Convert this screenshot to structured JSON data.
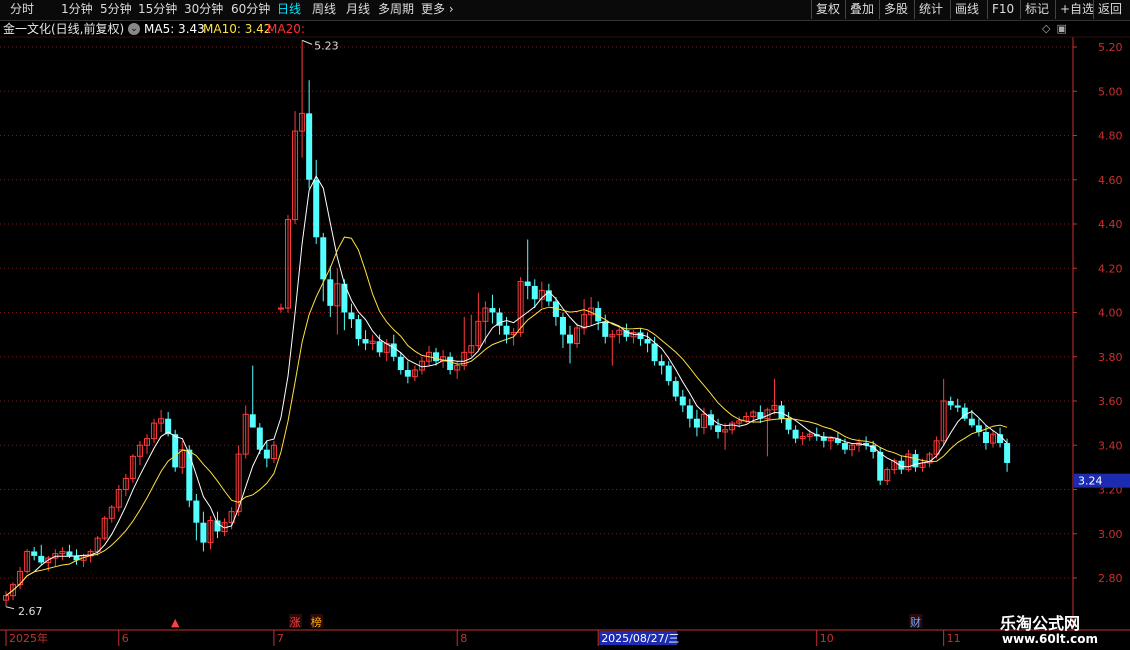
{
  "toolbar": {
    "left_items": [
      "分时",
      "1分钟",
      "5分钟",
      "15分钟",
      "30分钟",
      "60分钟",
      "日线",
      "周线",
      "月线",
      "多周期",
      "更多"
    ],
    "active": "日线",
    "right_items": [
      "复权",
      "叠加",
      "多股",
      "统计",
      "画线",
      "F10",
      "标记",
      "+自选",
      "返回"
    ]
  },
  "info": {
    "stock_name": "金一文化(日线,前复权)",
    "ma5": "MA5: 3.43",
    "ma10": "MA10: 3.42",
    "ma20": "MA20:"
  },
  "colors": {
    "up": "#ff3b3b",
    "down": "#54ffff",
    "ma5": "#ffffff",
    "ma10": "#ffe040",
    "grid": "#7a1a1a",
    "axis": "#c83030"
  },
  "chart_data": {
    "type": "candlestick",
    "ylim": [
      2.7,
      5.28
    ],
    "yticks": [
      "5.20",
      "5.00",
      "4.80",
      "4.60",
      "4.40",
      "4.20",
      "4.00",
      "3.80",
      "3.60",
      "3.40",
      "3.20",
      "3.00",
      "2.80"
    ],
    "current_price": "3.24",
    "high_label": "5.23",
    "low_label": "2.67",
    "x_labels": [
      {
        "label": "2025年",
        "index": 0
      },
      {
        "label": "6",
        "index": 16
      },
      {
        "label": "7",
        "index": 38
      },
      {
        "label": "8",
        "index": 64
      },
      {
        "label": "2025/08/27/三",
        "index": 84,
        "highlight": true
      },
      {
        "label": "10",
        "index": 115
      },
      {
        "label": "11",
        "index": 133
      }
    ],
    "markers": [
      {
        "label": "▲",
        "index": 24
      },
      {
        "label": "涨",
        "index": 41
      },
      {
        "label": "榜",
        "index": 44
      },
      {
        "label": "财",
        "index": 129
      }
    ],
    "ohlc": [
      [
        2.7,
        2.74,
        2.67,
        2.72
      ],
      [
        2.72,
        2.78,
        2.7,
        2.77
      ],
      [
        2.77,
        2.85,
        2.75,
        2.83
      ],
      [
        2.83,
        2.93,
        2.82,
        2.92
      ],
      [
        2.92,
        2.94,
        2.88,
        2.9
      ],
      [
        2.9,
        2.95,
        2.86,
        2.87
      ],
      [
        2.87,
        2.9,
        2.83,
        2.89
      ],
      [
        2.89,
        2.93,
        2.85,
        2.91
      ],
      [
        2.91,
        2.94,
        2.88,
        2.92
      ],
      [
        2.92,
        2.95,
        2.89,
        2.9
      ],
      [
        2.9,
        2.93,
        2.86,
        2.88
      ],
      [
        2.88,
        2.91,
        2.85,
        2.9
      ],
      [
        2.9,
        2.93,
        2.87,
        2.92
      ],
      [
        2.92,
        2.99,
        2.9,
        2.98
      ],
      [
        2.98,
        3.08,
        2.97,
        3.07
      ],
      [
        3.07,
        3.13,
        3.05,
        3.12
      ],
      [
        3.12,
        3.22,
        3.1,
        3.2
      ],
      [
        3.2,
        3.27,
        3.17,
        3.25
      ],
      [
        3.25,
        3.36,
        3.23,
        3.35
      ],
      [
        3.35,
        3.42,
        3.31,
        3.4
      ],
      [
        3.4,
        3.45,
        3.36,
        3.43
      ],
      [
        3.43,
        3.52,
        3.41,
        3.5
      ],
      [
        3.5,
        3.56,
        3.46,
        3.52
      ],
      [
        3.52,
        3.55,
        3.44,
        3.45
      ],
      [
        3.45,
        3.47,
        3.28,
        3.3
      ],
      [
        3.3,
        3.42,
        3.27,
        3.38
      ],
      [
        3.38,
        3.4,
        3.12,
        3.15
      ],
      [
        3.15,
        3.18,
        2.97,
        3.05
      ],
      [
        3.05,
        3.1,
        2.92,
        2.96
      ],
      [
        2.96,
        3.08,
        2.93,
        3.06
      ],
      [
        3.06,
        3.1,
        2.98,
        3.01
      ],
      [
        3.01,
        3.07,
        2.99,
        3.05
      ],
      [
        3.05,
        3.12,
        3.02,
        3.1
      ],
      [
        3.1,
        3.4,
        3.08,
        3.36
      ],
      [
        3.36,
        3.58,
        3.34,
        3.54
      ],
      [
        3.54,
        3.76,
        3.48,
        3.48
      ],
      [
        3.48,
        3.5,
        3.36,
        3.38
      ],
      [
        3.38,
        3.42,
        3.3,
        3.34
      ],
      [
        3.34,
        3.42,
        3.32,
        3.4
      ],
      [
        4.02,
        4.04,
        4.0,
        4.02
      ],
      [
        4.02,
        4.44,
        4.0,
        4.42
      ],
      [
        4.42,
        4.91,
        4.4,
        4.82
      ],
      [
        4.82,
        5.23,
        4.7,
        4.9
      ],
      [
        4.9,
        5.05,
        4.56,
        4.6
      ],
      [
        4.6,
        4.69,
        4.31,
        4.34
      ],
      [
        4.34,
        4.36,
        4.05,
        4.15
      ],
      [
        4.15,
        4.21,
        3.98,
        4.03
      ],
      [
        4.03,
        4.2,
        3.9,
        4.13
      ],
      [
        4.13,
        4.15,
        3.92,
        4.0
      ],
      [
        4.0,
        4.04,
        3.93,
        3.97
      ],
      [
        3.97,
        3.99,
        3.85,
        3.88
      ],
      [
        3.88,
        3.92,
        3.83,
        3.86
      ],
      [
        3.86,
        3.9,
        3.83,
        3.87
      ],
      [
        3.87,
        3.9,
        3.8,
        3.82
      ],
      [
        3.82,
        3.88,
        3.78,
        3.86
      ],
      [
        3.86,
        3.9,
        3.78,
        3.8
      ],
      [
        3.8,
        3.82,
        3.72,
        3.74
      ],
      [
        3.74,
        3.78,
        3.68,
        3.71
      ],
      [
        3.71,
        3.76,
        3.69,
        3.74
      ],
      [
        3.74,
        3.8,
        3.72,
        3.78
      ],
      [
        3.78,
        3.85,
        3.76,
        3.82
      ],
      [
        3.82,
        3.84,
        3.76,
        3.78
      ],
      [
        3.78,
        3.83,
        3.75,
        3.8
      ],
      [
        3.8,
        3.82,
        3.72,
        3.74
      ],
      [
        3.74,
        3.78,
        3.7,
        3.76
      ],
      [
        3.76,
        3.98,
        3.74,
        3.82
      ],
      [
        3.82,
        3.99,
        3.8,
        3.85
      ],
      [
        3.85,
        4.09,
        3.83,
        3.96
      ],
      [
        3.96,
        4.05,
        3.86,
        4.02
      ],
      [
        4.02,
        4.08,
        3.95,
        4.0
      ],
      [
        4.0,
        4.02,
        3.9,
        3.94
      ],
      [
        3.94,
        3.98,
        3.86,
        3.9
      ],
      [
        3.9,
        3.93,
        3.85,
        3.91
      ],
      [
        3.91,
        4.16,
        3.89,
        4.14
      ],
      [
        4.14,
        4.33,
        4.06,
        4.12
      ],
      [
        4.12,
        4.15,
        4.02,
        4.06
      ],
      [
        4.06,
        4.14,
        4.02,
        4.1
      ],
      [
        4.1,
        4.13,
        4.03,
        4.05
      ],
      [
        4.05,
        4.07,
        3.94,
        3.98
      ],
      [
        3.98,
        4.0,
        3.84,
        3.9
      ],
      [
        3.9,
        3.94,
        3.77,
        3.86
      ],
      [
        3.86,
        3.95,
        3.84,
        3.93
      ],
      [
        3.93,
        4.06,
        3.9,
        3.99
      ],
      [
        3.99,
        4.07,
        3.94,
        4.02
      ],
      [
        4.02,
        4.05,
        3.92,
        3.96
      ],
      [
        3.96,
        3.99,
        3.86,
        3.89
      ],
      [
        3.89,
        3.92,
        3.76,
        3.9
      ],
      [
        3.9,
        3.94,
        3.86,
        3.92
      ],
      [
        3.92,
        3.95,
        3.87,
        3.89
      ],
      [
        3.89,
        3.92,
        3.86,
        3.91
      ],
      [
        3.91,
        3.93,
        3.85,
        3.88
      ],
      [
        3.88,
        3.91,
        3.82,
        3.86
      ],
      [
        3.86,
        3.89,
        3.76,
        3.78
      ],
      [
        3.78,
        3.81,
        3.72,
        3.76
      ],
      [
        3.76,
        3.78,
        3.67,
        3.69
      ],
      [
        3.69,
        3.71,
        3.6,
        3.62
      ],
      [
        3.62,
        3.65,
        3.55,
        3.58
      ],
      [
        3.58,
        3.61,
        3.48,
        3.52
      ],
      [
        3.52,
        3.56,
        3.44,
        3.48
      ],
      [
        3.48,
        3.57,
        3.45,
        3.54
      ],
      [
        3.54,
        3.56,
        3.47,
        3.49
      ],
      [
        3.49,
        3.52,
        3.43,
        3.46
      ],
      [
        3.46,
        3.5,
        3.38,
        3.47
      ],
      [
        3.47,
        3.51,
        3.45,
        3.5
      ],
      [
        3.5,
        3.53,
        3.48,
        3.51
      ],
      [
        3.51,
        3.55,
        3.5,
        3.53
      ],
      [
        3.53,
        3.56,
        3.5,
        3.55
      ],
      [
        3.55,
        3.58,
        3.5,
        3.52
      ],
      [
        3.52,
        3.57,
        3.35,
        3.56
      ],
      [
        3.56,
        3.7,
        3.54,
        3.58
      ],
      [
        3.58,
        3.6,
        3.5,
        3.52
      ],
      [
        3.52,
        3.55,
        3.45,
        3.47
      ],
      [
        3.47,
        3.49,
        3.41,
        3.43
      ],
      [
        3.43,
        3.46,
        3.4,
        3.44
      ],
      [
        3.44,
        3.47,
        3.42,
        3.45
      ],
      [
        3.45,
        3.48,
        3.42,
        3.44
      ],
      [
        3.44,
        3.46,
        3.39,
        3.42
      ],
      [
        3.42,
        3.44,
        3.38,
        3.43
      ],
      [
        3.43,
        3.46,
        3.4,
        3.41
      ],
      [
        3.41,
        3.43,
        3.36,
        3.38
      ],
      [
        3.38,
        3.41,
        3.35,
        3.4
      ],
      [
        3.4,
        3.43,
        3.37,
        3.41
      ],
      [
        3.41,
        3.44,
        3.38,
        3.4
      ],
      [
        3.4,
        3.42,
        3.34,
        3.37
      ],
      [
        3.37,
        3.39,
        3.22,
        3.24
      ],
      [
        3.24,
        3.3,
        3.22,
        3.29
      ],
      [
        3.29,
        3.34,
        3.27,
        3.33
      ],
      [
        3.33,
        3.35,
        3.27,
        3.29
      ],
      [
        3.29,
        3.38,
        3.28,
        3.36
      ],
      [
        3.36,
        3.38,
        3.28,
        3.3
      ],
      [
        3.3,
        3.34,
        3.28,
        3.32
      ],
      [
        3.32,
        3.37,
        3.3,
        3.36
      ],
      [
        3.36,
        3.44,
        3.34,
        3.42
      ],
      [
        3.42,
        3.7,
        3.4,
        3.6
      ],
      [
        3.6,
        3.62,
        3.56,
        3.58
      ],
      [
        3.58,
        3.61,
        3.55,
        3.57
      ],
      [
        3.57,
        3.59,
        3.51,
        3.52
      ],
      [
        3.52,
        3.56,
        3.48,
        3.49
      ],
      [
        3.49,
        3.52,
        3.44,
        3.46
      ],
      [
        3.46,
        3.49,
        3.38,
        3.41
      ],
      [
        3.41,
        3.47,
        3.39,
        3.45
      ],
      [
        3.45,
        3.48,
        3.39,
        3.41
      ],
      [
        3.41,
        3.43,
        3.28,
        3.32
      ]
    ]
  },
  "watermark": {
    "line1": "乐淘公式网",
    "line2": "www.60lt.com"
  }
}
